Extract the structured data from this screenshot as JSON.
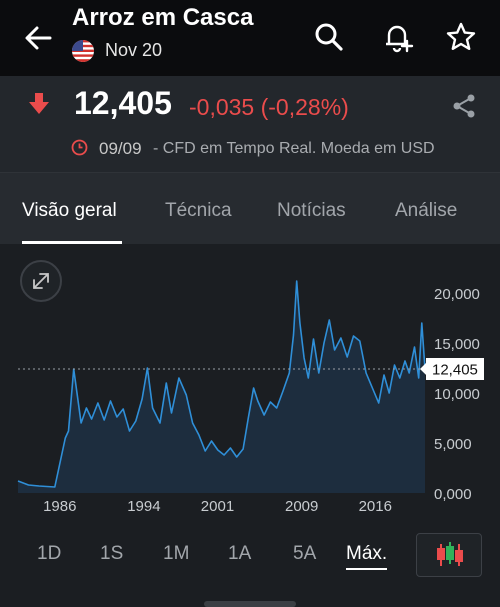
{
  "header": {
    "title": "Arroz em Casca",
    "subtitle": "Nov 20"
  },
  "quote": {
    "price": "12,405",
    "change": "-0,035 (-0,28%)",
    "date": "09/09",
    "description": "- CFD em Tempo Real. Moeda em USD"
  },
  "tabs": [
    {
      "label": "Visão geral",
      "active": true
    },
    {
      "label": "Técnica",
      "active": false
    },
    {
      "label": "Notícias",
      "active": false
    },
    {
      "label": "Análise",
      "active": false
    }
  ],
  "ranges": [
    {
      "label": "1D",
      "active": false
    },
    {
      "label": "1S",
      "active": false
    },
    {
      "label": "1M",
      "active": false
    },
    {
      "label": "1A",
      "active": false
    },
    {
      "label": "5A",
      "active": false
    },
    {
      "label": "Máx.",
      "active": true
    }
  ],
  "colors": {
    "line": "#2f8fd8",
    "negative": "#ea4c4c",
    "background": "#1b1e22"
  },
  "chart_data": {
    "type": "area",
    "x_ticks": [
      "1986",
      "1994",
      "2001",
      "2009",
      "2016"
    ],
    "y_ticks": [
      "20,000",
      "15,000",
      "10,000",
      "5,000",
      "0,000"
    ],
    "ylim": [
      0,
      23000
    ],
    "last_value_label": "12,405",
    "last_value": 12405,
    "x": [
      1982.0,
      1983.0,
      1984.0,
      1985.5,
      1986.5,
      1986.8,
      1987.3,
      1988.0,
      1988.5,
      1989.0,
      1989.6,
      1990.2,
      1990.8,
      1991.4,
      1992.0,
      1992.6,
      1993.2,
      1993.8,
      1994.3,
      1994.8,
      1995.5,
      1996.1,
      1996.6,
      1997.3,
      1998.0,
      1998.6,
      1999.2,
      1999.8,
      2000.4,
      2001.0,
      2001.6,
      2002.2,
      2002.8,
      2003.4,
      2003.9,
      2004.4,
      2004.8,
      2005.4,
      2006.0,
      2006.6,
      2007.2,
      2007.8,
      2008.2,
      2008.5,
      2008.8,
      2009.2,
      2009.6,
      2010.1,
      2010.6,
      2011.1,
      2011.6,
      2012.1,
      2012.7,
      2013.3,
      2013.9,
      2014.5,
      2015.1,
      2015.7,
      2016.3,
      2016.8,
      2017.3,
      2017.8,
      2018.3,
      2018.8,
      2019.2,
      2019.7,
      2020.1,
      2020.4,
      2020.7
    ],
    "y": [
      1200,
      800,
      700,
      600,
      5500,
      6200,
      12400,
      7000,
      8500,
      7400,
      9000,
      7300,
      9200,
      7600,
      8400,
      6200,
      7200,
      9400,
      12500,
      8500,
      7000,
      11000,
      8000,
      11500,
      9800,
      7000,
      5800,
      4200,
      5200,
      4300,
      3800,
      4500,
      3600,
      4400,
      7500,
      10500,
      9200,
      7800,
      9100,
      8500,
      10200,
      12000,
      15800,
      21200,
      17000,
      13500,
      11500,
      15400,
      12000,
      15000,
      17300,
      14300,
      15500,
      13600,
      15700,
      15200,
      12000,
      10500,
      9000,
      11800,
      10000,
      12800,
      11500,
      13200,
      12000,
      14600,
      11500,
      17000,
      12405
    ]
  }
}
